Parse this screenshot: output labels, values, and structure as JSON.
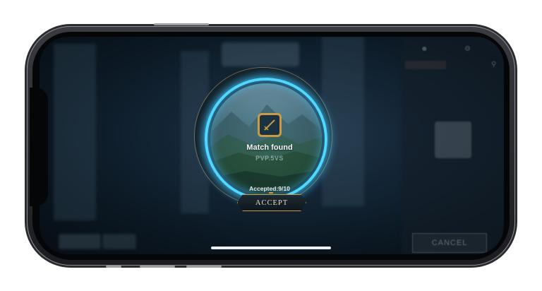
{
  "match": {
    "title": "Match found",
    "mode": "PVP.5VS",
    "accepted": "Accepted:9/10",
    "accept_label": "ACCEPT",
    "emblem_icon": "sword-emblem-icon"
  },
  "lobby": {
    "cancel_label": "CANCEL"
  },
  "colors": {
    "ring_glow": "#4fd8ff",
    "gold_accent": "#c89b4a",
    "screen_bg": "#0a1620"
  }
}
